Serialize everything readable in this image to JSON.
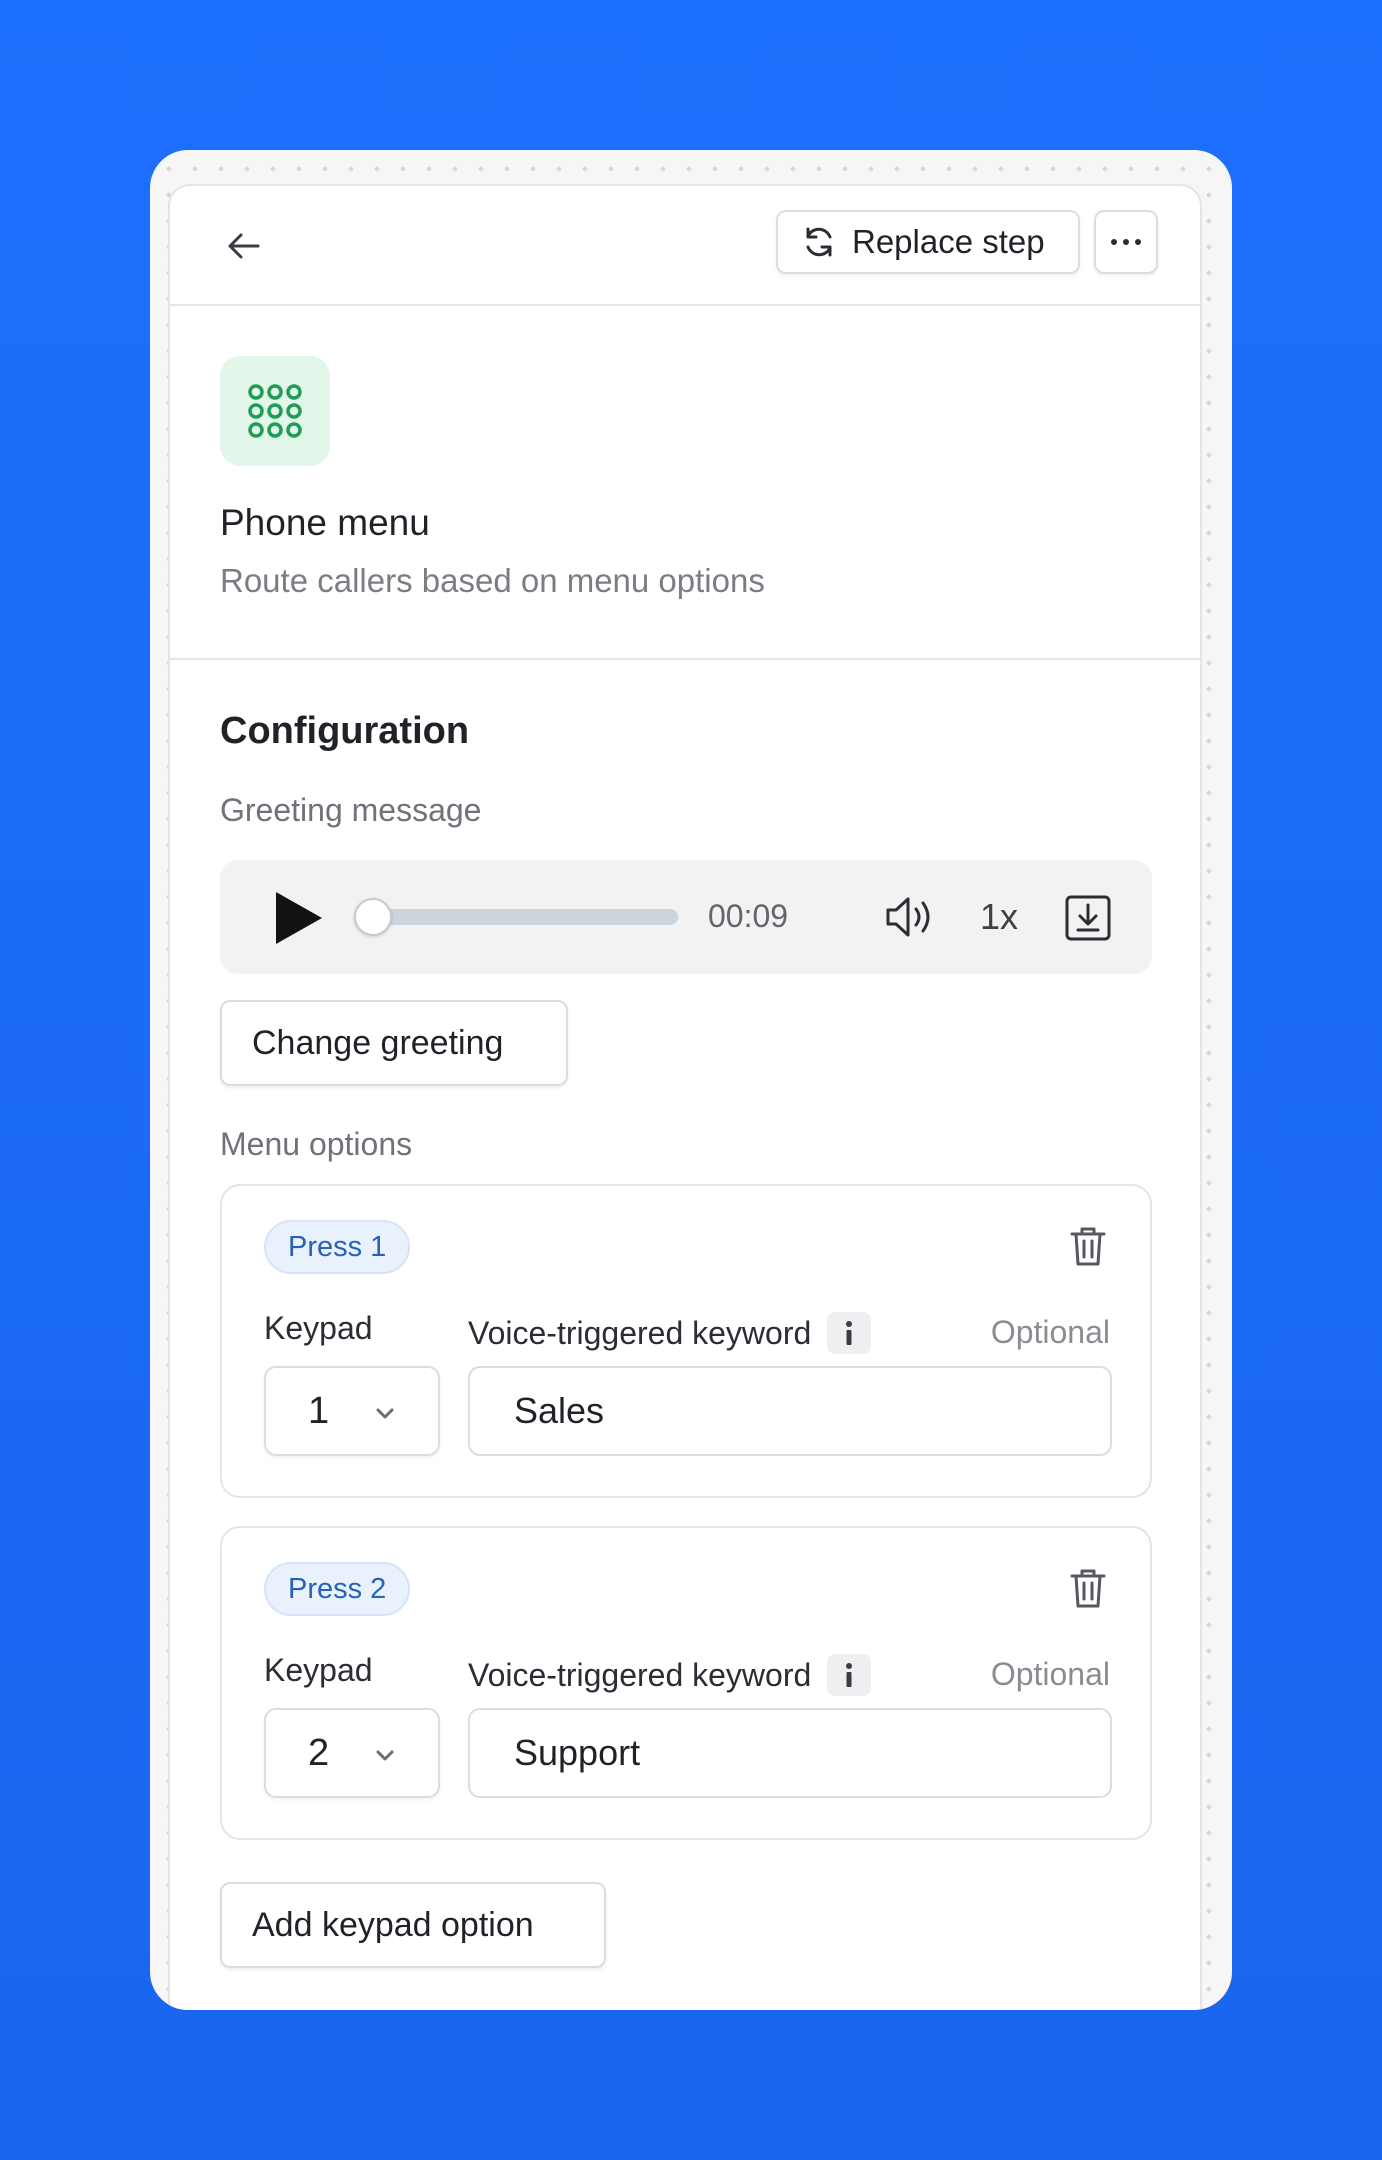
{
  "header": {
    "back_icon": "arrow-left-icon",
    "replace_label": "Replace step",
    "replace_icon": "refresh-icon",
    "more_icon": "ellipsis-icon"
  },
  "step": {
    "icon": "keypad-grid-icon",
    "icon_color": "#1f9d55",
    "title": "Phone menu",
    "subtitle": "Route callers based on menu options"
  },
  "configuration": {
    "title": "Configuration",
    "greeting_label": "Greeting message",
    "player": {
      "play_icon": "play-icon",
      "progress": 0,
      "time": "00:09",
      "volume_icon": "volume-icon",
      "speed": "1x",
      "download_icon": "download-icon"
    },
    "change_greeting_label": "Change greeting",
    "menu_options_label": "Menu options",
    "options": [
      {
        "badge": "Press 1",
        "keypad_label": "Keypad",
        "keypad_value": "1",
        "voice_label": "Voice-triggered keyword",
        "optional_label": "Optional",
        "keyword_value": "Sales"
      },
      {
        "badge": "Press 2",
        "keypad_label": "Keypad",
        "keypad_value": "2",
        "voice_label": "Voice-triggered keyword",
        "optional_label": "Optional",
        "keyword_value": "Support"
      }
    ],
    "add_option_label": "Add keypad option"
  },
  "colors": {
    "background": "#1d6ffd",
    "badge_text": "#2563b8",
    "badge_bg": "#e9f1fd",
    "icon_bg": "#e3f6ea"
  }
}
